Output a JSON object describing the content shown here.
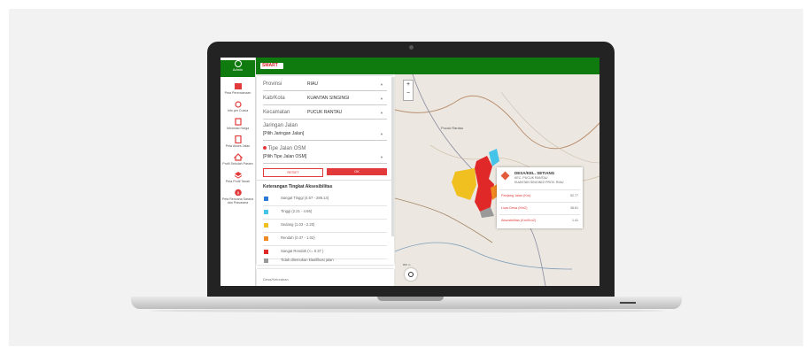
{
  "sidebar": {
    "top_label": "Admin",
    "items": [
      {
        "label": "Peta Perencanaan",
        "icon": "map-icon",
        "color": "#e23a3a"
      },
      {
        "label": "Info per Cuaca",
        "icon": "weather-icon",
        "color": "#e23a3a"
      },
      {
        "label": "Informasi Harga",
        "icon": "price-icon",
        "color": "#e23a3a"
      },
      {
        "label": "Peta Akses Jalan",
        "icon": "road-access-icon",
        "color": "#e23a3a"
      },
      {
        "label": "Profil Sekolah Pasien",
        "icon": "home-icon",
        "color": "#e23a3a"
      },
      {
        "label": "Peta Profil Tanah",
        "icon": "layers-icon",
        "color": "#e23a3a"
      },
      {
        "label": "Peta Rencana Sarana dan Prasarana",
        "icon": "info-icon",
        "color": "#e23a3a"
      }
    ]
  },
  "header": {
    "logo_text": "SMART",
    "brand_color": "#0f7b0f"
  },
  "filters": {
    "provinsi": {
      "label": "Provinsi",
      "value": "RIAU"
    },
    "kabkota": {
      "label": "Kab/Kota",
      "value": "KUANTAN SINGINGI"
    },
    "kecamatan": {
      "label": "Kecamatan",
      "value": "PUCUK RANTAU"
    },
    "jaringan": {
      "label": "Jaringan Jalan",
      "value": "[Pilih Jaringan Jalan]"
    },
    "tipe": {
      "label": "Tipe Jalan OSM",
      "value": "[Pilih Tipe Jalan OSM]"
    },
    "reset_label": "RESET",
    "ok_label": "OK"
  },
  "legend": {
    "title": "Keterangan Tingkat Aksesibilitas",
    "items": [
      {
        "label": "Sangat Tinggi (4.67 - 286.14)",
        "color": "#2b7bd6"
      },
      {
        "label": "Tinggi (2.21 - 4.66)",
        "color": "#46c3e8"
      },
      {
        "label": "Sedang (1.03 - 2.20)",
        "color": "#f0c020"
      },
      {
        "label": "Rendah (0.37 - 1.02)",
        "color": "#f08a20"
      },
      {
        "label": "Sangat Rendah (<= 0.37 )",
        "color": "#e02828"
      },
      {
        "label": "Tidak ditemukan klasifikasi jalan",
        "color": "#999999"
      }
    ]
  },
  "bottom_panel": {
    "label": "Desa/Kelurahan"
  },
  "map": {
    "zoom_in": "+",
    "zoom_out": "−",
    "scale_text": "800 m",
    "places": [
      "Pucuk Rantau"
    ]
  },
  "popup": {
    "title": "DESA/KEL. SETIANG",
    "sub1": "KEC. PUCUK RANTAU",
    "sub2": "KUANTAN SINGINGI PROV. RIAU",
    "rows": [
      {
        "key": "Panjang Jalan (Km)",
        "value": "52.77"
      },
      {
        "key": "Luas Desa (Km2)",
        "value": "38.61"
      },
      {
        "key": "Aksesibilitas (Km/Km2)",
        "value": "1.41"
      }
    ]
  }
}
